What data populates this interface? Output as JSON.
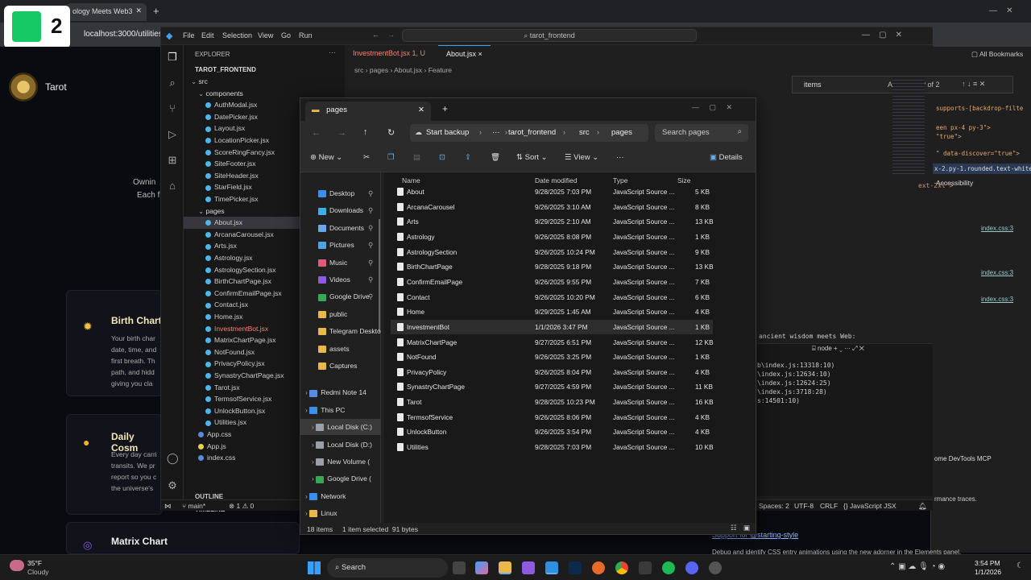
{
  "browser": {
    "tab_title": "ology Meets Web3",
    "url": "localhost:3000/utilities"
  },
  "k2": {
    "label": "2"
  },
  "site": {
    "brand": "Tarot",
    "hero_line1": "Ownin",
    "hero_line2": "Each f",
    "cards": [
      {
        "title": "Birth Chart",
        "lines": [
          "Your birth char",
          "date, time, and",
          "first breath. Th",
          "path, and hidd",
          "giving you cla"
        ]
      },
      {
        "title": "Daily Cosm",
        "lines": [
          "Every day carri",
          "transits. We pr",
          "report so you c",
          "the universe's"
        ]
      },
      {
        "title": "Matrix Chart",
        "lines": []
      }
    ]
  },
  "vscode": {
    "menu": [
      "File",
      "Edit",
      "Selection",
      "View",
      "Go",
      "Run"
    ],
    "command_center": "tarot_frontend",
    "explorer_title": "EXPLORER",
    "project": "TAROT_FRONTEND",
    "tree": [
      {
        "label": "src",
        "indent": 1,
        "folder": true
      },
      {
        "label": "components",
        "indent": 2,
        "folder": true
      },
      {
        "label": "AuthModal.jsx",
        "indent": 3
      },
      {
        "label": "DatePicker.jsx",
        "indent": 3
      },
      {
        "label": "Layout.jsx",
        "indent": 3
      },
      {
        "label": "LocationPicker.jsx",
        "indent": 3
      },
      {
        "label": "ScoreRingFancy.jsx",
        "indent": 3
      },
      {
        "label": "SiteFooter.jsx",
        "indent": 3
      },
      {
        "label": "SiteHeader.jsx",
        "indent": 3
      },
      {
        "label": "StarField.jsx",
        "indent": 3
      },
      {
        "label": "TimePicker.jsx",
        "indent": 3
      },
      {
        "label": "pages",
        "indent": 2,
        "folder": true
      },
      {
        "label": "About.jsx",
        "indent": 3,
        "selected": true
      },
      {
        "label": "ArcanaCarousel.jsx",
        "indent": 3
      },
      {
        "label": "Arts.jsx",
        "indent": 3
      },
      {
        "label": "Astrology.jsx",
        "indent": 3
      },
      {
        "label": "AstrologySection.jsx",
        "indent": 3
      },
      {
        "label": "BirthChartPage.jsx",
        "indent": 3
      },
      {
        "label": "ConfirmEmailPage.jsx",
        "indent": 3
      },
      {
        "label": "Contact.jsx",
        "indent": 3
      },
      {
        "label": "Home.jsx",
        "indent": 3
      },
      {
        "label": "InvestmentBot.jsx",
        "indent": 3,
        "red": true
      },
      {
        "label": "MatrixChartPage.jsx",
        "indent": 3
      },
      {
        "label": "NotFound.jsx",
        "indent": 3
      },
      {
        "label": "PrivacyPolicy.jsx",
        "indent": 3
      },
      {
        "label": "SynastryChartPage.jsx",
        "indent": 3
      },
      {
        "label": "Tarot.jsx",
        "indent": 3
      },
      {
        "label": "TermsofService.jsx",
        "indent": 3
      },
      {
        "label": "UnlockButton.jsx",
        "indent": 3
      },
      {
        "label": "Utilities.jsx",
        "indent": 3
      },
      {
        "label": "App.css",
        "indent": 2
      },
      {
        "label": "App.js",
        "indent": 2
      },
      {
        "label": "index.css",
        "indent": 2
      },
      {
        "label": "index.js",
        "indent": 2
      }
    ],
    "outline": "OUTLINE",
    "timeline": "TIMELINE",
    "tabs": [
      {
        "label": "InvestmentBot.jsx",
        "suffix": "1, U"
      },
      {
        "label": "About.jsx",
        "suffix": "×"
      }
    ],
    "breadcrumb": [
      "src",
      "pages",
      "About.jsx",
      "Feature"
    ],
    "find_query": "items",
    "find_result": "? of 2",
    "terminal_header": "node",
    "terminal_lines": [
      "ancient wisdom meets Web:",
      "b\\index.js:13318:10)",
      "\\index.js:12634:10)",
      "\\index.js:12624:25)",
      "\\index.js:3718:28)",
      "s:14501:10)"
    ],
    "code_snippet": "ext-2xl\">",
    "status": {
      "branch": "main*",
      "problems": "⊗ 1 ⚠ 0",
      "spaces": "Spaces: 2",
      "encoding": "UTF-8",
      "eol": "CRLF",
      "language": "{} JavaScript JSX"
    }
  },
  "devtools": {
    "bookmarks": "All Bookmarks",
    "css_lines": [
      "supports-[backdrop-filte",
      "een px-4 py-3\">",
      "\"true\">",
      "\" data-discover=\"true\">",
      "x-2.py-1.rounded.text-white"
    ],
    "accessibility": "Accessibility",
    "index_links": [
      "index.css:3",
      "index.css:3",
      "index.css:3"
    ],
    "mcp": "ome DevTools MCP",
    "traces": "rmance traces.",
    "starting_style": "Support for @starting-style",
    "debug_text": "Debug and identify CSS entry animations using the new adorner in the Elements panel."
  },
  "explorer": {
    "tab_title": "pages",
    "path": [
      "Start backup",
      "···",
      "tarot_frontend",
      "src",
      "pages"
    ],
    "search_placeholder": "Search pages",
    "toolbar": {
      "new": "New",
      "sort": "Sort",
      "view": "View",
      "details": "Details"
    },
    "columns": {
      "name": "Name",
      "date": "Date modified",
      "type": "Type",
      "size": "Size"
    },
    "nav": [
      {
        "label": "Desktop",
        "color": "#3b8eea",
        "pinned": true
      },
      {
        "label": "Downloads",
        "color": "#3bb0ea",
        "pinned": true
      },
      {
        "label": "Documents",
        "color": "#6aa6e8",
        "pinned": true
      },
      {
        "label": "Pictures",
        "color": "#4fa3e0",
        "pinned": true
      },
      {
        "label": "Music",
        "color": "#e05a7a",
        "pinned": true
      },
      {
        "label": "Videos",
        "color": "#8e5ae0",
        "pinned": true
      },
      {
        "label": "Google Drive",
        "color": "#34a853",
        "pinned": true
      },
      {
        "label": "public",
        "color": "#e8b84a"
      },
      {
        "label": "Telegram Deskto",
        "color": "#e8b84a"
      },
      {
        "label": "assets",
        "color": "#e8b84a"
      },
      {
        "label": "Captures",
        "color": "#e8b84a"
      },
      {
        "label": "Redmi Note 14",
        "color": "#5a8ae0",
        "expand": true
      },
      {
        "label": "This PC",
        "color": "#3b8eea",
        "expand": true
      },
      {
        "label": "Local Disk (C:)",
        "color": "#9aa0a6",
        "expand": true,
        "selected": true,
        "sub": true
      },
      {
        "label": "Local Disk (D:)",
        "color": "#9aa0a6",
        "expand": true,
        "sub": true
      },
      {
        "label": "New Volume (",
        "color": "#9aa0a6",
        "expand": true,
        "sub": true
      },
      {
        "label": "Google Drive (",
        "color": "#34a853",
        "expand": true,
        "sub": true
      },
      {
        "label": "Network",
        "color": "#3b8eea",
        "expand": true
      },
      {
        "label": "Linux",
        "color": "#e8b84a",
        "expand": true
      }
    ],
    "files": [
      {
        "name": "About",
        "date": "9/28/2025 7:03 PM",
        "type": "JavaScript Source ...",
        "size": "5 KB"
      },
      {
        "name": "ArcanaCarousel",
        "date": "9/26/2025 3:10 AM",
        "type": "JavaScript Source ...",
        "size": "8 KB"
      },
      {
        "name": "Arts",
        "date": "9/29/2025 2:10 AM",
        "type": "JavaScript Source ...",
        "size": "13 KB"
      },
      {
        "name": "Astrology",
        "date": "9/26/2025 8:08 PM",
        "type": "JavaScript Source ...",
        "size": "1 KB"
      },
      {
        "name": "AstrologySection",
        "date": "9/26/2025 10:24 PM",
        "type": "JavaScript Source ...",
        "size": "9 KB"
      },
      {
        "name": "BirthChartPage",
        "date": "9/28/2025 9:18 PM",
        "type": "JavaScript Source ...",
        "size": "13 KB"
      },
      {
        "name": "ConfirmEmailPage",
        "date": "9/26/2025 9:55 PM",
        "type": "JavaScript Source ...",
        "size": "7 KB"
      },
      {
        "name": "Contact",
        "date": "9/26/2025 10:20 PM",
        "type": "JavaScript Source ...",
        "size": "6 KB"
      },
      {
        "name": "Home",
        "date": "9/29/2025 1:45 AM",
        "type": "JavaScript Source ...",
        "size": "4 KB"
      },
      {
        "name": "InvestmentBot",
        "date": "1/1/2026 3:47 PM",
        "type": "JavaScript Source ...",
        "size": "1 KB",
        "selected": true
      },
      {
        "name": "MatrixChartPage",
        "date": "9/27/2025 6:51 PM",
        "type": "JavaScript Source ...",
        "size": "12 KB"
      },
      {
        "name": "NotFound",
        "date": "9/26/2025 3:25 PM",
        "type": "JavaScript Source ...",
        "size": "1 KB"
      },
      {
        "name": "PrivacyPolicy",
        "date": "9/26/2025 8:04 PM",
        "type": "JavaScript Source ...",
        "size": "4 KB"
      },
      {
        "name": "SynastryChartPage",
        "date": "9/27/2025 4:59 PM",
        "type": "JavaScript Source ...",
        "size": "11 KB"
      },
      {
        "name": "Tarot",
        "date": "9/28/2025 10:23 PM",
        "type": "JavaScript Source ...",
        "size": "16 KB"
      },
      {
        "name": "TermsofService",
        "date": "9/26/2025 8:06 PM",
        "type": "JavaScript Source ...",
        "size": "4 KB"
      },
      {
        "name": "UnlockButton",
        "date": "9/26/2025 3:54 PM",
        "type": "JavaScript Source ...",
        "size": "4 KB"
      },
      {
        "name": "Utilities",
        "date": "9/28/2025 7:03 PM",
        "type": "JavaScript Source ...",
        "size": "10 KB"
      }
    ],
    "status_items": "18 items",
    "status_selected": "1 item selected  91 bytes"
  },
  "taskbar": {
    "weather_temp": "35°F",
    "weather_desc": "Cloudy",
    "search": "Search",
    "time": "3:54 PM",
    "date": "1/1/2026"
  }
}
